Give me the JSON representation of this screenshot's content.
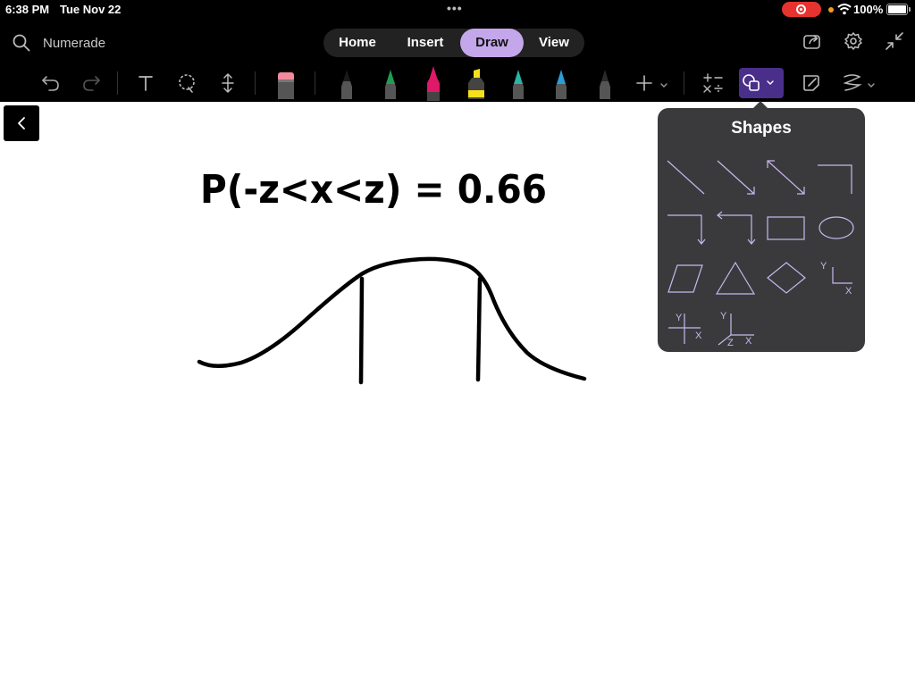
{
  "status": {
    "time": "6:38 PM",
    "date": "Tue Nov 22",
    "dots": "•••",
    "battery": "100%"
  },
  "header": {
    "app_title": "Numerade",
    "tabs": [
      {
        "label": "Home",
        "active": false
      },
      {
        "label": "Insert",
        "active": false
      },
      {
        "label": "Draw",
        "active": true
      },
      {
        "label": "View",
        "active": false
      }
    ]
  },
  "toolbar": {
    "tools": [
      "undo-icon",
      "redo-icon",
      "text-tool-icon",
      "lasso-icon",
      "insert-space-icon",
      "eraser-icon",
      "pen-black-icon",
      "pen-green-icon",
      "pen-magenta-icon",
      "highlighter-yellow-icon",
      "pen-teal-icon",
      "pen-blue-icon",
      "pen-dark-icon",
      "add-pen-icon",
      "math-icon",
      "shapes-icon",
      "ink-to-shape-icon",
      "replay-icon"
    ],
    "pen_colors": {
      "black": "#1a1a1a",
      "green": "#1f9d55",
      "magenta": "#e0186a",
      "yellow": "#f7e01c",
      "teal": "#2bb3a3",
      "blue": "#2a9fd6",
      "dark": "#2b2b2b"
    },
    "accent": "#c4a7ea"
  },
  "canvas": {
    "equation": "P(-z<x<z) = 0.66"
  },
  "shapes_panel": {
    "title": "Shapes",
    "shapes": [
      "line",
      "arrow",
      "double-arrow",
      "elbow",
      "elbow-arrow",
      "elbow-double-arrow",
      "rectangle",
      "ellipse",
      "parallelogram",
      "triangle",
      "diamond",
      "xy-axes",
      "xy-cross-axes",
      "xyz-axes"
    ],
    "axis_labels": {
      "x": "X",
      "y": "Y",
      "z": "Z"
    }
  }
}
